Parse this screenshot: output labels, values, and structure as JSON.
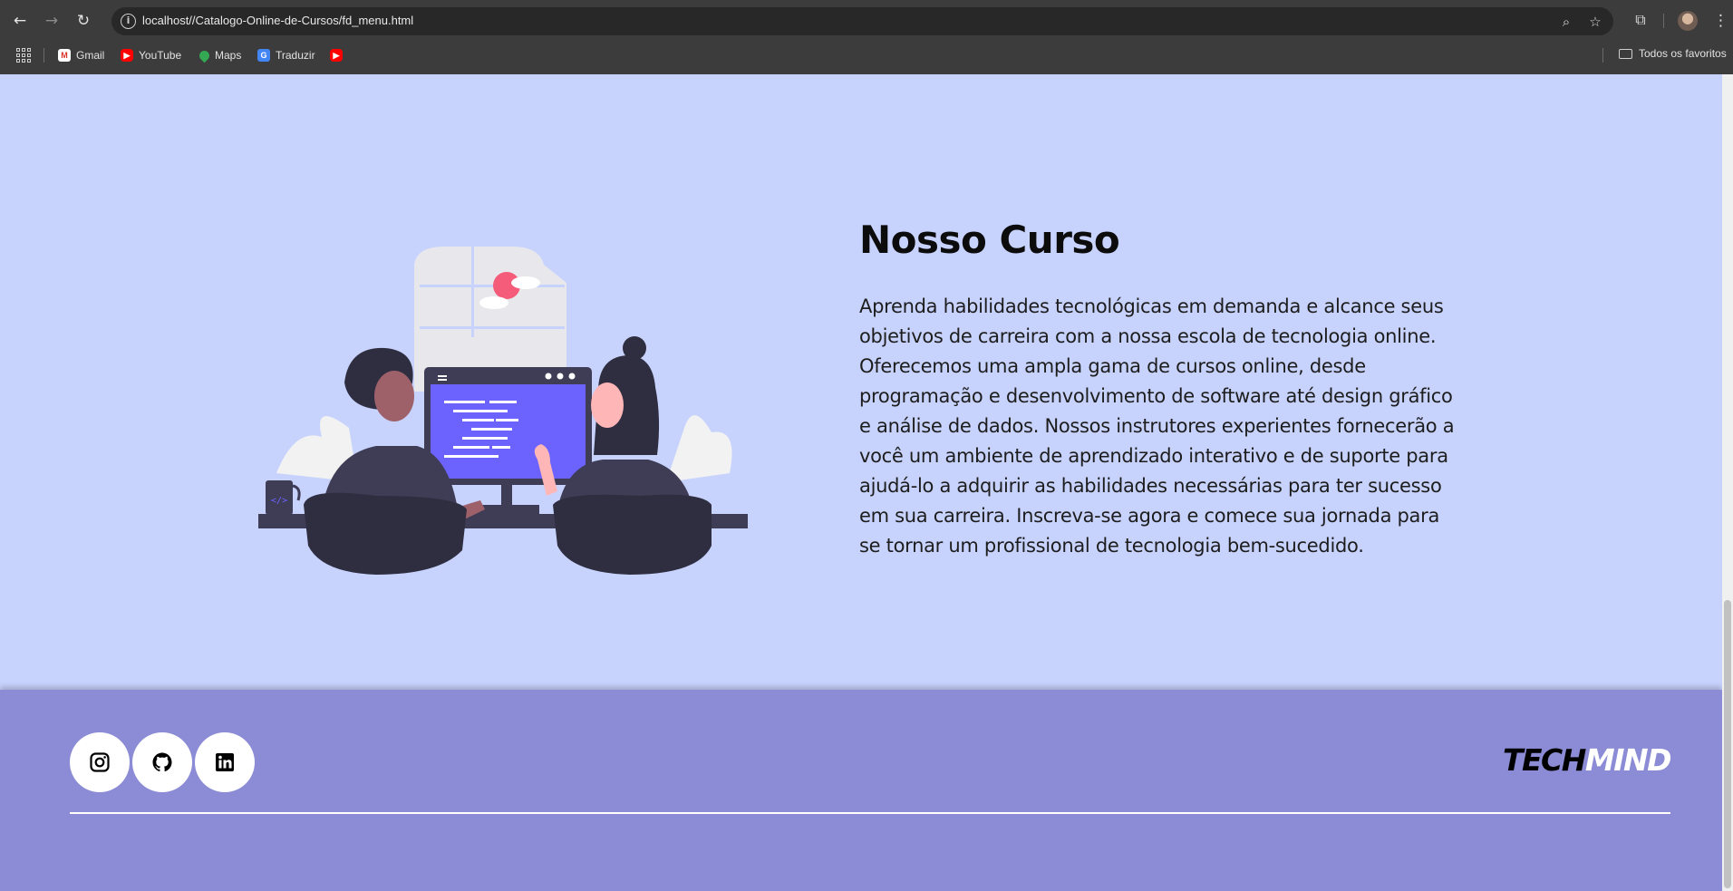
{
  "browser": {
    "url": "localhost//Catalogo-Online-de-Cursos/fd_menu.html",
    "nav": {
      "back": "←",
      "forward": "→",
      "reload": "↻"
    },
    "bookmarks": [
      {
        "label": "Gmail",
        "icon": "gmail-icon"
      },
      {
        "label": "YouTube",
        "icon": "youtube-icon"
      },
      {
        "label": "Maps",
        "icon": "maps-icon"
      },
      {
        "label": "Traduzir",
        "icon": "translate-icon"
      },
      {
        "label": "",
        "icon": "youtube-icon"
      }
    ],
    "all_bookmarks_label": "Todos os favoritos"
  },
  "hero": {
    "title": "Nosso Curso",
    "text": "Aprenda habilidades tecnológicas em demanda e alcance seus objetivos de carreira com a nossa escola de tecnologia online. Oferecemos uma ampla gama de cursos online, desde programação e desenvolvimento de software até design gráfico e análise de dados. Nossos instrutores experientes fornecerão a você um ambiente de aprendizado interativo e de suporte para ajudá-lo a adquirir as habilidades necessárias para ter sucesso em sua carreira. Inscreva-se agora e comece sua jornada para se tornar um profissional de tecnologia bem-sucedido.",
    "illustration_icon": "two-people-coding-illustration"
  },
  "footer": {
    "social": [
      {
        "name": "instagram",
        "icon": "instagram-icon"
      },
      {
        "name": "github",
        "icon": "github-icon"
      },
      {
        "name": "linkedin",
        "icon": "linkedin-icon"
      }
    ],
    "brand": {
      "part1": "TECH",
      "part2": "MIND"
    }
  },
  "colors": {
    "hero_bg": "#c8d3fd",
    "footer_bg": "#8b8cd5",
    "accent": "#6c63ff"
  }
}
